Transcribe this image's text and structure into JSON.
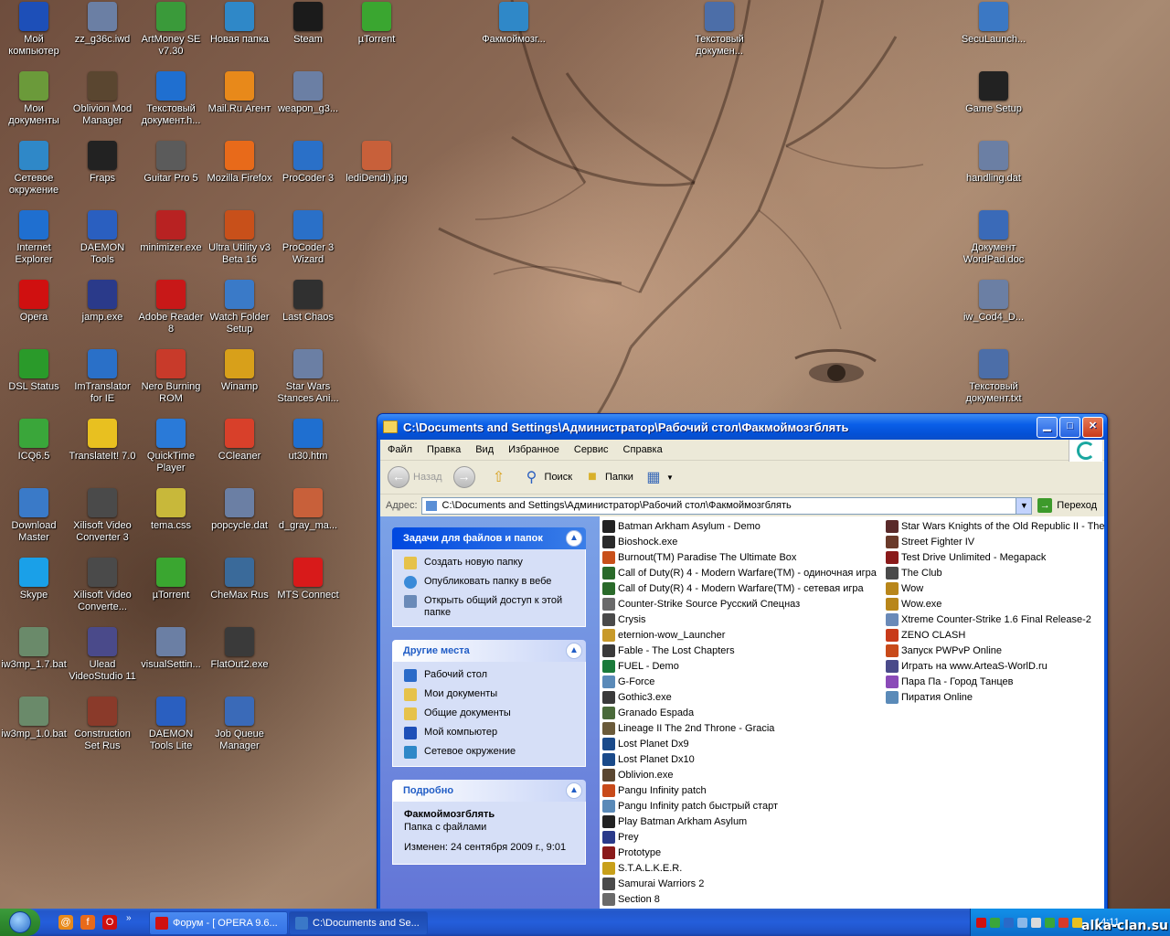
{
  "desktop": {
    "icons": [
      {
        "label": "Мой компьютер",
        "icon": "computer-icon",
        "color": "#1d4fb8"
      },
      {
        "label": "zz_g36c.iwd",
        "icon": "windows-file-icon",
        "color": "#6b7fa4"
      },
      {
        "label": "ArtMoney SE v7.30",
        "icon": "money-icon",
        "color": "#3a9a3a"
      },
      {
        "label": "Новая папка",
        "icon": "folder-icon",
        "color": "#2f88c8"
      },
      {
        "label": "Steam",
        "icon": "steam-icon",
        "color": "#1b1b1b"
      },
      {
        "label": "µTorrent",
        "icon": "utorrent-icon",
        "color": "#3aa630"
      },
      {
        "label": "Факмоймозг...",
        "icon": "folder-icon",
        "color": "#2f88c8"
      },
      {
        "label": "Текстовый докумен...",
        "icon": "text-document-icon",
        "color": "#4c6ea8"
      },
      {
        "label": "SecuLaunch...",
        "icon": "window-icon",
        "color": "#3b78c4"
      },
      {
        "label": "Мои документы",
        "icon": "my-documents-icon",
        "color": "#6b9a3a"
      },
      {
        "label": "Oblivion Mod Manager",
        "icon": "oblivion-icon",
        "color": "#5a4630"
      },
      {
        "label": "Текстовый документ.h...",
        "icon": "ie-icon",
        "color": "#1f6fd0"
      },
      {
        "label": "Mail.Ru Агент",
        "icon": "mail-agent-icon",
        "color": "#e8891a"
      },
      {
        "label": "weapon_g3...",
        "icon": "windows-file-icon",
        "color": "#6b7fa4"
      },
      {
        "label": "Game Setup",
        "icon": "game-setup-icon",
        "color": "#222222"
      },
      {
        "label": "Сетевое окружение",
        "icon": "network-icon",
        "color": "#2f88c8"
      },
      {
        "label": "Fraps",
        "icon": "fraps-icon",
        "color": "#222222"
      },
      {
        "label": "Guitar Pro 5",
        "icon": "guitar-pro-icon",
        "color": "#5b5b5b"
      },
      {
        "label": "Mozilla Firefox",
        "icon": "firefox-icon",
        "color": "#e86a1a"
      },
      {
        "label": "ProCoder 3",
        "icon": "procoder-icon",
        "color": "#2a70c8"
      },
      {
        "label": "lediDendi).jpg",
        "icon": "image-file-icon",
        "color": "#c8603a"
      },
      {
        "label": "handling.dat",
        "icon": "windows-file-icon",
        "color": "#6b7fa4"
      },
      {
        "label": "Internet Explorer",
        "icon": "ie-icon",
        "color": "#1f6fd0"
      },
      {
        "label": "DAEMON Tools",
        "icon": "daemon-tools-icon",
        "color": "#2a5fc0"
      },
      {
        "label": "minimizer.exe",
        "icon": "minimizer-icon",
        "color": "#b82222"
      },
      {
        "label": "Ultra Utility v3 Beta 16",
        "icon": "ultra-utility-icon",
        "color": "#c8501a"
      },
      {
        "label": "ProCoder 3 Wizard",
        "icon": "procoder-icon",
        "color": "#2a70c8"
      },
      {
        "label": "Документ WordPad.doc",
        "icon": "wordpad-icon",
        "color": "#3a6ab8"
      },
      {
        "label": "Opera",
        "icon": "opera-icon",
        "color": "#d01010"
      },
      {
        "label": "jamp.exe",
        "icon": "jedi-icon",
        "color": "#2a3a8a"
      },
      {
        "label": "Adobe Reader 8",
        "icon": "adobe-reader-icon",
        "color": "#c81818"
      },
      {
        "label": "Watch Folder Setup",
        "icon": "watch-folder-icon",
        "color": "#3a7ac8"
      },
      {
        "label": "Last Chaos",
        "icon": "last-chaos-icon",
        "color": "#303030"
      },
      {
        "label": "iw_Cod4_D...",
        "icon": "windows-file-icon",
        "color": "#6b7fa4"
      },
      {
        "label": "DSL Status",
        "icon": "dsl-status-icon",
        "color": "#2a9a2a"
      },
      {
        "label": "ImTranslator for IE",
        "icon": "translator-icon",
        "color": "#2a70c8"
      },
      {
        "label": "Nero Burning ROM",
        "icon": "nero-icon",
        "color": "#c83a2a"
      },
      {
        "label": "Winamp",
        "icon": "winamp-icon",
        "color": "#d8a01a"
      },
      {
        "label": "Star Wars Stances Ani...",
        "icon": "windows-file-icon",
        "color": "#6b7fa4"
      },
      {
        "label": "Текстовый документ.txt",
        "icon": "text-document-icon",
        "color": "#4c6ea8"
      },
      {
        "label": "ICQ6.5",
        "icon": "icq-icon",
        "color": "#3aa63a"
      },
      {
        "label": "TranslateIt! 7.0",
        "icon": "translateit-icon",
        "color": "#e8c020"
      },
      {
        "label": "QuickTime Player",
        "icon": "quicktime-icon",
        "color": "#2a7ad8"
      },
      {
        "label": "CCleaner",
        "icon": "ccleaner-icon",
        "color": "#d8402a"
      },
      {
        "label": "ut30.htm",
        "icon": "ie-icon",
        "color": "#1f6fd0"
      },
      {
        "label": "Download Master",
        "icon": "download-master-icon",
        "color": "#3a7ac8"
      },
      {
        "label": "Xilisoft Video Converter 3",
        "icon": "video-converter-icon",
        "color": "#4a4a4a"
      },
      {
        "label": "tema.css",
        "icon": "css-file-icon",
        "color": "#c8b83a"
      },
      {
        "label": "popcycle.dat",
        "icon": "windows-file-icon",
        "color": "#6b7fa4"
      },
      {
        "label": "d_gray_ma...",
        "icon": "image-file-icon",
        "color": "#c8603a"
      },
      {
        "label": "Skype",
        "icon": "skype-icon",
        "color": "#1aa0e8"
      },
      {
        "label": "Xilisoft Video Converte...",
        "icon": "video-converter-icon",
        "color": "#4a4a4a"
      },
      {
        "label": "µTorrent",
        "icon": "utorrent-icon",
        "color": "#3aa630"
      },
      {
        "label": "CheMax Rus",
        "icon": "chemax-icon",
        "color": "#3a6a9a"
      },
      {
        "label": "MTS Connect",
        "icon": "mts-connect-icon",
        "color": "#d81a1a"
      },
      {
        "label": "iw3mp_1.7.bat",
        "icon": "bat-file-icon",
        "color": "#6a8a6a"
      },
      {
        "label": "Ulead VideoStudio 11",
        "icon": "ulead-icon",
        "color": "#4a4a8a"
      },
      {
        "label": "visualSettin...",
        "icon": "windows-file-icon",
        "color": "#6b7fa4"
      },
      {
        "label": "FlatOut2.exe",
        "icon": "flatout-icon",
        "color": "#3a3a3a"
      },
      {
        "label": "iw3mp_1.0.bat",
        "icon": "bat-file-icon",
        "color": "#6a8a6a"
      },
      {
        "label": "Construction Set Rus",
        "icon": "construction-set-icon",
        "color": "#8a3a2a"
      },
      {
        "label": "DAEMON Tools Lite",
        "icon": "daemon-tools-icon",
        "color": "#2a5fc0"
      },
      {
        "label": "Job Queue Manager",
        "icon": "job-queue-icon",
        "color": "#3a6ab8"
      }
    ]
  },
  "window": {
    "title": "C:\\Documents and Settings\\Администратор\\Рабочий стол\\Факмоймозгблять",
    "menu": [
      "Файл",
      "Правка",
      "Вид",
      "Избранное",
      "Сервис",
      "Справка"
    ],
    "toolbar": {
      "back": "Назад",
      "search": "Поиск",
      "folders": "Папки"
    },
    "address": {
      "label": "Адрес:",
      "value": "C:\\Documents and Settings\\Администратор\\Рабочий стол\\Факмоймозгблять",
      "go": "Переход"
    },
    "tasks": {
      "file_tasks_title": "Задачи для файлов и папок",
      "file_tasks": [
        "Создать новую папку",
        "Опубликовать папку в вебе",
        "Открыть общий доступ к этой папке"
      ],
      "other_places_title": "Другие места",
      "other_places": [
        "Рабочий стол",
        "Мои документы",
        "Общие документы",
        "Мой компьютер",
        "Сетевое окружение"
      ],
      "details_title": "Подробно",
      "details_name": "Факмоймозгблять",
      "details_type": "Папка с файлами",
      "details_modified": "Изменен: 24 сентября 2009 г., 9:01"
    },
    "files_col1": [
      {
        "name": "Batman Arkham Asylum - Demo",
        "color": "#222222"
      },
      {
        "name": "Bioshock.exe",
        "color": "#2a2a2a"
      },
      {
        "name": "Burnout(TM) Paradise The Ultimate Box",
        "color": "#c8501a"
      },
      {
        "name": "Call of Duty(R) 4 - Modern Warfare(TM) - одиночная игра",
        "color": "#2a6a2a"
      },
      {
        "name": "Call of Duty(R) 4 - Modern Warfare(TM) - сетевая игра",
        "color": "#2a6a2a"
      },
      {
        "name": "Counter-Strike Source Русский Спецназ",
        "color": "#6a6a6a"
      },
      {
        "name": "Crysis",
        "color": "#4a4a4a"
      },
      {
        "name": "eternion-wow_Launcher",
        "color": "#c89a2a"
      },
      {
        "name": "Fable - The Lost Chapters",
        "color": "#3a3a3a"
      },
      {
        "name": "FUEL - Demo",
        "color": "#1a7a3a"
      },
      {
        "name": "G-Force",
        "color": "#5a8ab8"
      },
      {
        "name": "Gothic3.exe",
        "color": "#3a3a3a"
      },
      {
        "name": "Granado Espada",
        "color": "#4a6a3a"
      },
      {
        "name": "Lineage II The 2nd Throne - Gracia",
        "color": "#6a5a3a"
      },
      {
        "name": "Lost Planet Dx9",
        "color": "#1a4a8a"
      },
      {
        "name": "Lost Planet Dx10",
        "color": "#1a4a8a"
      },
      {
        "name": "Oblivion.exe",
        "color": "#5a4630"
      },
      {
        "name": "Pangu Infinity patch",
        "color": "#c84a1a"
      },
      {
        "name": "Pangu Infinity patch быстрый старт",
        "color": "#5a8ab8"
      },
      {
        "name": "Play Batman Arkham Asylum",
        "color": "#222222"
      },
      {
        "name": "Prey",
        "color": "#2a3a8a"
      },
      {
        "name": "Prototype",
        "color": "#8a1a1a"
      },
      {
        "name": "S.T.A.L.K.E.R.",
        "color": "#c8a01a"
      },
      {
        "name": "Samurai Warriors 2",
        "color": "#4a4a4a"
      },
      {
        "name": "Section 8",
        "color": "#6a6a6a"
      }
    ],
    "files_col2": [
      {
        "name": "Star Wars Knights of the Old Republic II - The S",
        "color": "#5a2a2a"
      },
      {
        "name": "Street Fighter IV",
        "color": "#6a3a2a"
      },
      {
        "name": "Test Drive Unlimited - Megapack",
        "color": "#8a1a1a"
      },
      {
        "name": "The Club",
        "color": "#4a4a4a"
      },
      {
        "name": "Wow",
        "color": "#b8861a"
      },
      {
        "name": "Wow.exe",
        "color": "#b8861a"
      },
      {
        "name": "Xtreme Counter-Strike 1.6 Final Release-2",
        "color": "#6a8ab8"
      },
      {
        "name": "ZENO CLASH",
        "color": "#c83a1a"
      },
      {
        "name": "Запуск PWPvP Online",
        "color": "#c84a1a"
      },
      {
        "name": "Играть на www.ArteaS-WorlD.ru",
        "color": "#4a4a8a"
      },
      {
        "name": "Пара Па - Город Танцев",
        "color": "#8a4ab8"
      },
      {
        "name": "Пиратия Online",
        "color": "#5a8ab8"
      }
    ]
  },
  "taskbar": {
    "buttons": [
      {
        "label": "Форум - [ OPERA 9.6...",
        "color": "#d01010"
      },
      {
        "label": "C:\\Documents and Se...",
        "color": "#3a78c8"
      }
    ],
    "clock": "14:11",
    "watermark": "alka-clan.su",
    "quick_launch": [
      {
        "icon": "mail-agent-icon",
        "color": "#e8891a",
        "glyph": "@"
      },
      {
        "icon": "firefox-icon",
        "color": "#e86a1a",
        "glyph": "f"
      },
      {
        "icon": "opera-icon",
        "color": "#d01010",
        "glyph": "O"
      }
    ]
  }
}
